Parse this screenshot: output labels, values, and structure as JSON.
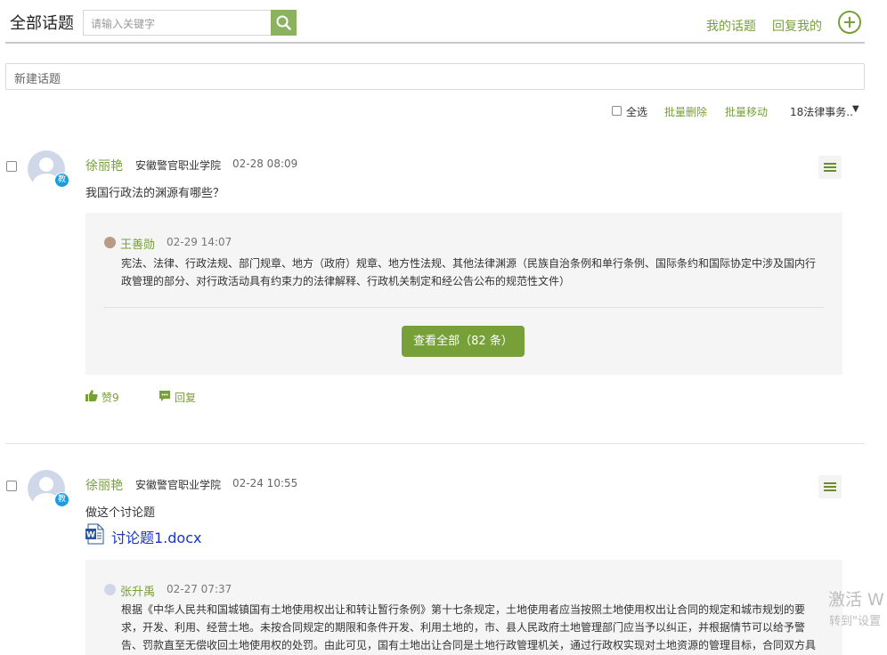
{
  "header": {
    "title": "全部话题",
    "search_placeholder": "请输入关键字",
    "my_topics": "我的话题",
    "replies_to_me": "回复我的"
  },
  "new_topic": "新建话题",
  "toolbar": {
    "select_all": "全选",
    "batch_delete": "批量删除",
    "batch_move": "批量移动",
    "course": "18法律事务.."
  },
  "posts": [
    {
      "author": "徐丽艳",
      "school": "安徽警官职业学院",
      "time": "02-28 08:09",
      "badge": "教",
      "text": "我国行政法的渊源有哪些？",
      "reply": {
        "author": "王善勋",
        "time": "02-29 14:07",
        "text_line1": "宪法、法律、行政法规、部门规章、地方（政府）规章、地方性法规、其他法律渊源（民族自治条例和单行条例、国际条约和国际协定中涉及国内行",
        "text_line2": "政管理的部分、对行政活动具有约束力的法律解释、行政机关制定和经公告公布的规范性文件）"
      },
      "view_all": "查看全部（82 条）",
      "like": "赞9",
      "reply_label": "回复"
    },
    {
      "author": "徐丽艳",
      "school": "安徽警官职业学院",
      "time": "02-24 10:55",
      "badge": "教",
      "text": "做这个讨论题",
      "attachment": "讨论题1.docx",
      "reply": {
        "author": "张升禹",
        "time": "02-27 07:37",
        "text_line1": "根据《中华人民共和国城镇国有土地使用权出让和转让暂行条例》第十七条规定，土地使用者应当按照土地使用权出让合同的规定和城市规划的要",
        "text_line2": "求，开发、利用、经营土地。未按合同规定的期限和条件开发、利用土地的，市、县人民政府土地管理部门应当予以纠正，并根据情节可以给予警",
        "text_line3": "告、罚款直至无偿收回土地使用权的处罚。由此可见，国有土地出让合同是土地行政管理机关，通过行政权实现对土地资源的管理目标，合同双方具"
      }
    }
  ],
  "watermark": {
    "line1": "激活 W",
    "line2": "转到\"设置"
  }
}
